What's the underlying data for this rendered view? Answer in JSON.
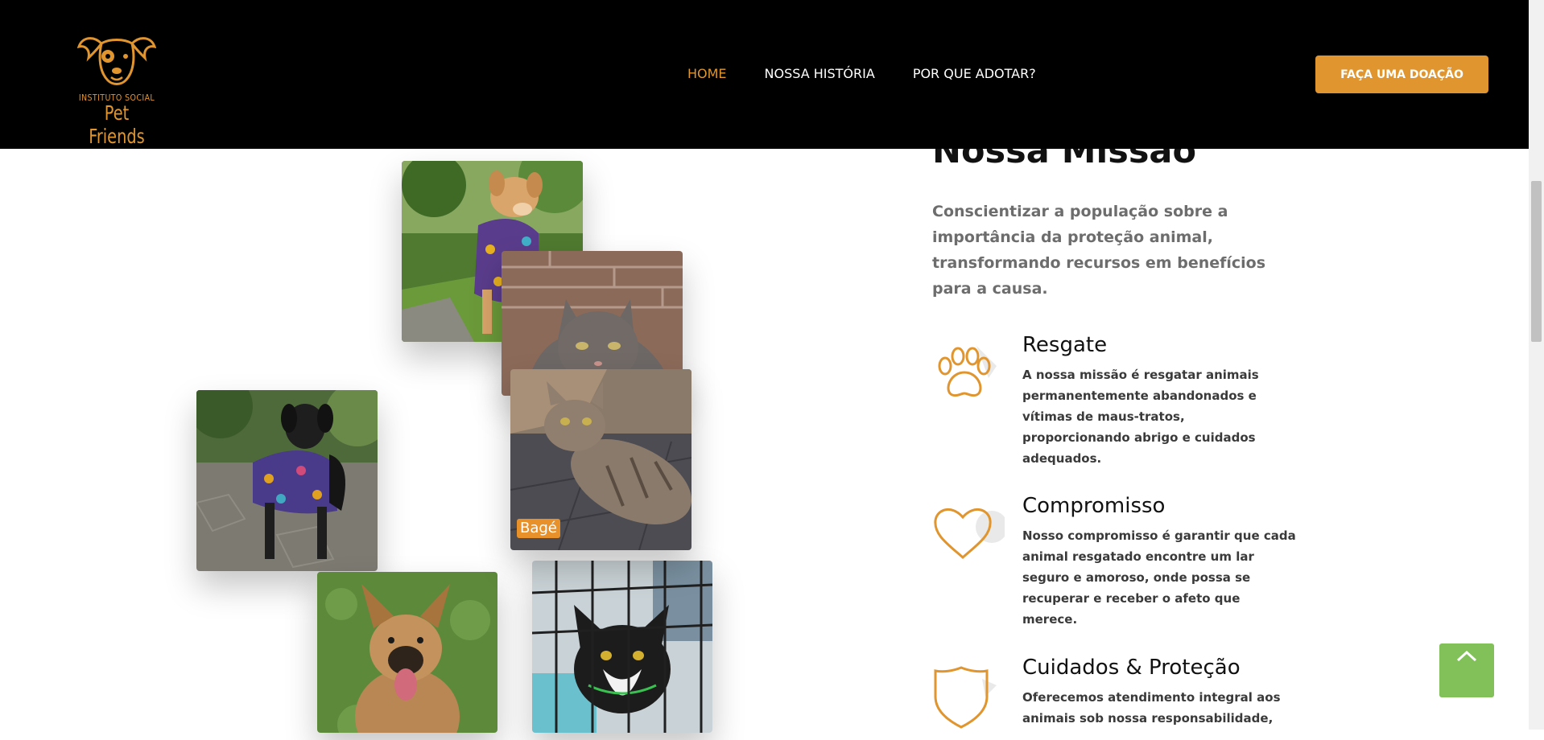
{
  "header": {
    "logo": {
      "sub": "INSTITUTO SOCIAL",
      "main": "Pet Friends"
    },
    "nav": [
      {
        "label": "HOME",
        "active": true
      },
      {
        "label": "NOSSA HISTÓRIA",
        "active": false
      },
      {
        "label": "POR QUE ADOTAR?",
        "active": false
      }
    ],
    "donate_label": "FAÇA UMA DOAÇÃO"
  },
  "gallery": {
    "caption_bage": "Bagé"
  },
  "mission": {
    "title": "Nossa Missão",
    "description": "Conscientizar a população sobre a importância da proteção animal, transformando recursos em benefícios para a causa.",
    "features": [
      {
        "icon": "paw-icon",
        "title": "Resgate",
        "text": "A nossa missão é resgatar animais permanentemente abandonados e vítimas de maus-tratos, proporcionando abrigo e cuidados adequados."
      },
      {
        "icon": "heart-icon",
        "title": "Compromisso",
        "text": "Nosso compromisso é garantir que cada animal resgatado encontre um lar seguro e amoroso, onde possa se recuperar e receber o afeto que merece."
      },
      {
        "icon": "shield-icon",
        "title": "Cuidados & Proteção",
        "text": "Oferecemos atendimento integral aos animais sob nossa responsabilidade,"
      }
    ]
  },
  "colors": {
    "accent": "#e0952e",
    "header_bg": "#000000",
    "back_to_top": "#82c15a"
  }
}
